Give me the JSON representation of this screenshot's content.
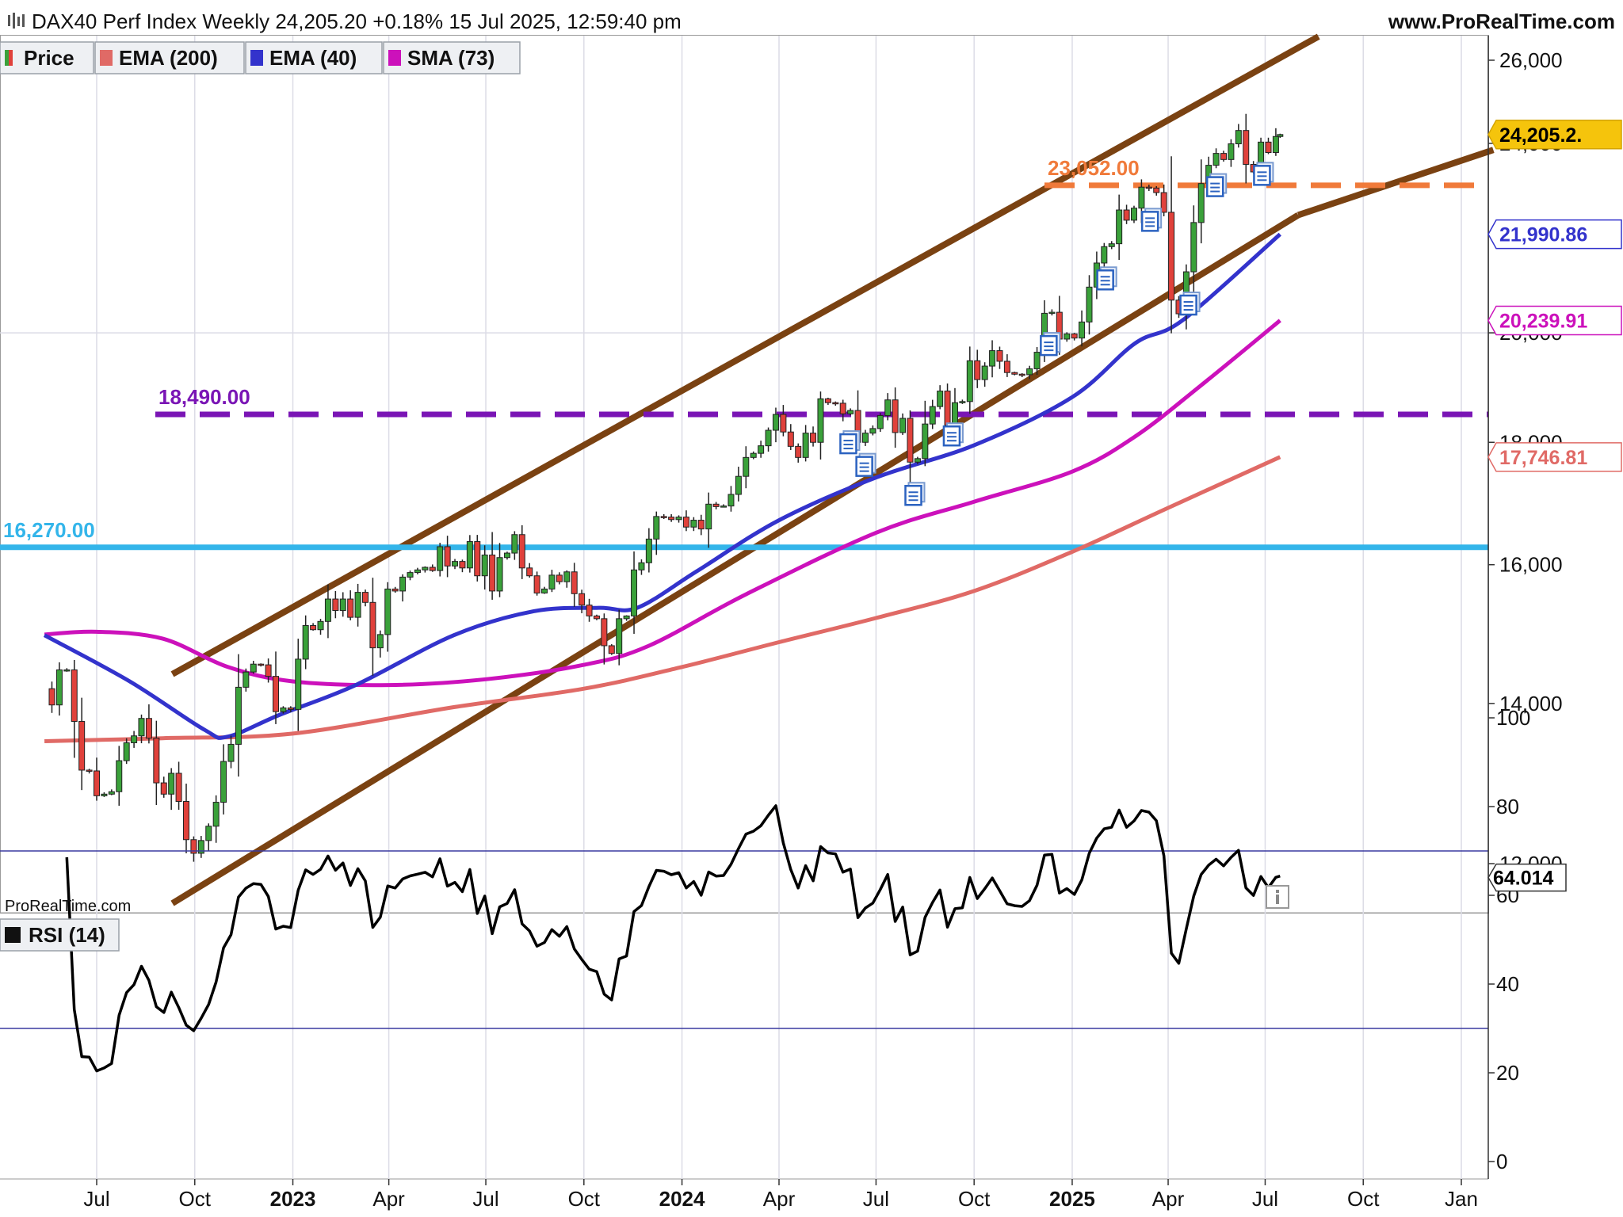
{
  "header": {
    "title": "DAX40 Perf Index Weekly 24,205.20 +0.18% 15 Jul 2025, 12:59:40 pm",
    "site": "www.ProRealTime.com",
    "watermark": "ProRealTime.com"
  },
  "legend": [
    {
      "label": "Price",
      "color": "#3aa13a",
      "color2": "#e0413b"
    },
    {
      "label": "EMA (200)",
      "color": "#e06a66"
    },
    {
      "label": "EMA (40)",
      "color": "#3333cc"
    },
    {
      "label": "SMA (73)",
      "color": "#cc11bb"
    }
  ],
  "rsi_legend": {
    "label": "RSI (14)",
    "color": "#111111"
  },
  "chart_data": [
    {
      "type": "candlestick",
      "name": "DAX40 Perf Index Weekly",
      "y_scale": "log",
      "ylim": [
        11400,
        26800
      ],
      "y_ticks": [
        12000,
        14000,
        16000,
        18000,
        20000,
        22000,
        24000,
        26000
      ],
      "y_tick_labels": [
        "12,000",
        "14,000",
        "16,000",
        "18,000",
        "20,000",
        "22,000",
        "24,000",
        "26,000"
      ],
      "x_tick_labels": [
        "Jul",
        "Oct",
        "2023",
        "Apr",
        "Jul",
        "Oct",
        "2024",
        "Apr",
        "Jul",
        "Oct",
        "2025",
        "Apr",
        "Jul",
        "Oct",
        "Jan"
      ],
      "x_tick_dates": [
        "2022-07-01",
        "2022-10-01",
        "2023-01-01",
        "2023-04-01",
        "2023-07-01",
        "2023-10-01",
        "2024-01-01",
        "2024-04-01",
        "2024-07-01",
        "2024-10-01",
        "2025-01-01",
        "2025-04-01",
        "2025-07-01",
        "2025-10-01",
        "2026-01-01"
      ],
      "x_year_labels": [
        "2023",
        "2024",
        "2025"
      ],
      "series_close": [
        [
          "2022-05-13",
          14200
        ],
        [
          "2022-05-20",
          13980
        ],
        [
          "2022-05-27",
          14460
        ],
        [
          "2022-06-03",
          14460
        ],
        [
          "2022-06-10",
          13760
        ],
        [
          "2022-06-17",
          13130
        ],
        [
          "2022-06-24",
          13120
        ],
        [
          "2022-07-01",
          12810
        ],
        [
          "2022-07-08",
          12830
        ],
        [
          "2022-07-15",
          12860
        ],
        [
          "2022-07-22",
          13250
        ],
        [
          "2022-07-29",
          13480
        ],
        [
          "2022-08-05",
          13570
        ],
        [
          "2022-08-12",
          13800
        ],
        [
          "2022-08-19",
          13540
        ],
        [
          "2022-08-26",
          12970
        ],
        [
          "2022-09-02",
          12830
        ],
        [
          "2022-09-09",
          13090
        ],
        [
          "2022-09-16",
          12740
        ],
        [
          "2022-09-23",
          12280
        ],
        [
          "2022-09-30",
          12120
        ],
        [
          "2022-10-07",
          12270
        ],
        [
          "2022-10-14",
          12440
        ],
        [
          "2022-10-21",
          12730
        ],
        [
          "2022-10-28",
          13240
        ],
        [
          "2022-11-04",
          13460
        ],
        [
          "2022-11-11",
          14220
        ],
        [
          "2022-11-18",
          14430
        ],
        [
          "2022-11-25",
          14540
        ],
        [
          "2022-12-02",
          14530
        ],
        [
          "2022-12-09",
          14370
        ],
        [
          "2022-12-16",
          13890
        ],
        [
          "2022-12-23",
          13940
        ],
        [
          "2022-12-30",
          13920
        ],
        [
          "2023-01-06",
          14610
        ],
        [
          "2023-01-13",
          15090
        ],
        [
          "2023-01-20",
          15030
        ],
        [
          "2023-01-27",
          15150
        ],
        [
          "2023-02-03",
          15480
        ],
        [
          "2023-02-10",
          15310
        ],
        [
          "2023-02-17",
          15480
        ],
        [
          "2023-02-24",
          15210
        ],
        [
          "2023-03-03",
          15580
        ],
        [
          "2023-03-10",
          15430
        ],
        [
          "2023-03-17",
          14770
        ],
        [
          "2023-03-24",
          14960
        ],
        [
          "2023-03-31",
          15630
        ],
        [
          "2023-04-07",
          15600
        ],
        [
          "2023-04-14",
          15810
        ],
        [
          "2023-04-21",
          15880
        ],
        [
          "2023-04-28",
          15920
        ],
        [
          "2023-05-05",
          15960
        ],
        [
          "2023-05-12",
          15910
        ],
        [
          "2023-05-19",
          16280
        ],
        [
          "2023-05-26",
          15980
        ],
        [
          "2023-06-02",
          16050
        ],
        [
          "2023-06-09",
          15950
        ],
        [
          "2023-06-16",
          16360
        ],
        [
          "2023-06-23",
          15830
        ],
        [
          "2023-06-30",
          16150
        ],
        [
          "2023-07-07",
          15600
        ],
        [
          "2023-07-14",
          16110
        ],
        [
          "2023-07-21",
          16180
        ],
        [
          "2023-07-28",
          16470
        ],
        [
          "2023-08-04",
          15950
        ],
        [
          "2023-08-11",
          15830
        ],
        [
          "2023-08-18",
          15570
        ],
        [
          "2023-08-25",
          15630
        ],
        [
          "2023-09-01",
          15840
        ],
        [
          "2023-09-08",
          15740
        ],
        [
          "2023-09-15",
          15890
        ],
        [
          "2023-09-22",
          15560
        ],
        [
          "2023-09-29",
          15390
        ],
        [
          "2023-10-06",
          15230
        ],
        [
          "2023-10-13",
          15190
        ],
        [
          "2023-10-20",
          14800
        ],
        [
          "2023-10-27",
          14690
        ],
        [
          "2023-11-03",
          15190
        ],
        [
          "2023-11-10",
          15230
        ],
        [
          "2023-11-17",
          15920
        ],
        [
          "2023-11-24",
          16030
        ],
        [
          "2023-12-01",
          16400
        ],
        [
          "2023-12-08",
          16760
        ],
        [
          "2023-12-15",
          16750
        ],
        [
          "2023-12-22",
          16710
        ],
        [
          "2023-12-29",
          16750
        ],
        [
          "2024-01-05",
          16590
        ],
        [
          "2024-01-12",
          16700
        ],
        [
          "2024-01-19",
          16560
        ],
        [
          "2024-01-26",
          16960
        ],
        [
          "2024-02-02",
          16920
        ],
        [
          "2024-02-09",
          16930
        ],
        [
          "2024-02-16",
          17120
        ],
        [
          "2024-02-23",
          17420
        ],
        [
          "2024-03-01",
          17740
        ],
        [
          "2024-03-08",
          17810
        ],
        [
          "2024-03-15",
          17940
        ],
        [
          "2024-03-22",
          18210
        ],
        [
          "2024-03-29",
          18490
        ],
        [
          "2024-04-05",
          18180
        ],
        [
          "2024-04-12",
          17930
        ],
        [
          "2024-04-19",
          17740
        ],
        [
          "2024-04-26",
          18160
        ],
        [
          "2024-05-03",
          18000
        ],
        [
          "2024-05-10",
          18770
        ],
        [
          "2024-05-17",
          18700
        ],
        [
          "2024-05-24",
          18690
        ],
        [
          "2024-05-31",
          18500
        ],
        [
          "2024-06-07",
          18560
        ],
        [
          "2024-06-14",
          18000
        ],
        [
          "2024-06-21",
          18160
        ],
        [
          "2024-06-28",
          18240
        ],
        [
          "2024-07-05",
          18470
        ],
        [
          "2024-07-12",
          18750
        ],
        [
          "2024-07-19",
          18170
        ],
        [
          "2024-07-26",
          18420
        ],
        [
          "2024-08-02",
          17660
        ],
        [
          "2024-08-09",
          17720
        ],
        [
          "2024-08-16",
          18320
        ],
        [
          "2024-08-23",
          18630
        ],
        [
          "2024-08-30",
          18910
        ],
        [
          "2024-09-06",
          18300
        ],
        [
          "2024-09-13",
          18700
        ],
        [
          "2024-09-20",
          18720
        ],
        [
          "2024-09-27",
          19470
        ],
        [
          "2024-10-04",
          19120
        ],
        [
          "2024-10-11",
          19370
        ],
        [
          "2024-10-18",
          19660
        ],
        [
          "2024-10-25",
          19460
        ],
        [
          "2024-11-01",
          19250
        ],
        [
          "2024-11-08",
          19220
        ],
        [
          "2024-11-15",
          19210
        ],
        [
          "2024-11-22",
          19320
        ],
        [
          "2024-11-29",
          19630
        ],
        [
          "2024-12-06",
          20380
        ],
        [
          "2024-12-13",
          20400
        ],
        [
          "2024-12-20",
          19880
        ],
        [
          "2024-12-27",
          19980
        ],
        [
          "2025-01-03",
          19900
        ],
        [
          "2025-01-10",
          20210
        ],
        [
          "2025-01-17",
          20900
        ],
        [
          "2025-01-24",
          21390
        ],
        [
          "2025-01-31",
          21730
        ],
        [
          "2025-02-07",
          21790
        ],
        [
          "2025-02-14",
          22510
        ],
        [
          "2025-02-21",
          22290
        ],
        [
          "2025-02-28",
          22550
        ],
        [
          "2025-03-07",
          23010
        ],
        [
          "2025-03-14",
          22990
        ],
        [
          "2025-03-21",
          22890
        ],
        [
          "2025-03-28",
          22460
        ],
        [
          "2025-04-04",
          20640
        ],
        [
          "2025-04-11",
          20370
        ],
        [
          "2025-04-18",
          21210
        ],
        [
          "2025-04-25",
          22240
        ],
        [
          "2025-05-02",
          23090
        ],
        [
          "2025-05-09",
          23500
        ],
        [
          "2025-05-16",
          23770
        ],
        [
          "2025-05-23",
          23630
        ],
        [
          "2025-05-30",
          23990
        ],
        [
          "2025-06-06",
          24300
        ],
        [
          "2025-06-13",
          23520
        ],
        [
          "2025-06-20",
          23350
        ],
        [
          "2025-06-27",
          24030
        ],
        [
          "2025-07-04",
          23790
        ],
        [
          "2025-07-11",
          24160
        ],
        [
          "2025-07-15",
          24205.2
        ]
      ],
      "last_price": "24,205.2.",
      "indicators": {
        "ema40_last": "21,990.86",
        "sma73_last": "20,239.91",
        "ema200_last": "17,746.81"
      },
      "ema40": [
        [
          "2022-05-13",
          14950
        ],
        [
          "2022-08-01",
          14300
        ],
        [
          "2022-10-10",
          13650
        ],
        [
          "2022-11-01",
          13560
        ],
        [
          "2022-12-20",
          13850
        ],
        [
          "2023-03-01",
          14250
        ],
        [
          "2023-06-01",
          14950
        ],
        [
          "2023-08-15",
          15300
        ],
        [
          "2023-10-15",
          15350
        ],
        [
          "2023-11-20",
          15350
        ],
        [
          "2024-01-15",
          15900
        ],
        [
          "2024-04-01",
          16700
        ],
        [
          "2024-07-01",
          17400
        ],
        [
          "2024-10-01",
          17950
        ],
        [
          "2025-01-01",
          18800
        ],
        [
          "2025-03-01",
          19800
        ],
        [
          "2025-04-15",
          20250
        ],
        [
          "2025-07-15",
          21990.86
        ]
      ],
      "sma73": [
        [
          "2022-05-13",
          14960
        ],
        [
          "2022-07-01",
          15000
        ],
        [
          "2022-09-01",
          14900
        ],
        [
          "2022-11-01",
          14500
        ],
        [
          "2023-01-01",
          14300
        ],
        [
          "2023-04-01",
          14250
        ],
        [
          "2023-07-01",
          14330
        ],
        [
          "2023-10-01",
          14530
        ],
        [
          "2023-12-01",
          14800
        ],
        [
          "2024-03-01",
          15550
        ],
        [
          "2024-07-01",
          16500
        ],
        [
          "2024-10-01",
          17000
        ],
        [
          "2025-01-01",
          17500
        ],
        [
          "2025-03-01",
          18100
        ],
        [
          "2025-05-01",
          19000
        ],
        [
          "2025-07-15",
          20239.91
        ]
      ],
      "ema200": [
        [
          "2022-05-13",
          13500
        ],
        [
          "2022-09-01",
          13540
        ],
        [
          "2023-01-01",
          13600
        ],
        [
          "2023-06-01",
          13950
        ],
        [
          "2023-10-01",
          14200
        ],
        [
          "2024-01-01",
          14500
        ],
        [
          "2024-04-01",
          14850
        ],
        [
          "2024-07-01",
          15200
        ],
        [
          "2024-10-01",
          15600
        ],
        [
          "2025-01-01",
          16200
        ],
        [
          "2025-04-01",
          16900
        ],
        [
          "2025-07-15",
          17746.81
        ]
      ],
      "channel_upper": [
        [
          "2022-09-10",
          14400
        ],
        [
          "2025-08-20",
          26600
        ]
      ],
      "channel_lower": [
        [
          "2022-09-10",
          11550
        ],
        [
          "2025-08-01",
          22400
        ]
      ],
      "channel_lower_ext": [
        [
          "2025-08-01",
          22400
        ],
        [
          "2026-01-31",
          23850
        ]
      ],
      "horizontal_lines": [
        {
          "value": 23052.0,
          "label": "23,052.00",
          "color": "#f07a3a",
          "dashed": true,
          "from": "2025-01-01"
        },
        {
          "value": 18490.0,
          "label": "18,490.00",
          "color": "#7a15b5",
          "dashed": true,
          "from": "2022-09-01"
        },
        {
          "value": 16270.0,
          "label": "16,270.00",
          "color": "#33b5ea",
          "dashed": false,
          "from": "2022-05-13"
        }
      ],
      "event_markers": [
        "2024-06-05",
        "2024-06-20",
        "2024-08-05",
        "2024-09-10",
        "2024-12-10",
        "2025-02-01",
        "2025-03-15",
        "2025-04-20",
        "2025-05-15",
        "2025-06-28"
      ]
    },
    {
      "type": "line",
      "name": "RSI (14)",
      "ylim": [
        -5,
        105
      ],
      "y_ticks": [
        0,
        20,
        40,
        60,
        80,
        100
      ],
      "y_tick_labels": [
        "0",
        "20",
        "40",
        "60",
        "80",
        "100"
      ],
      "levels": [
        30,
        70
      ],
      "last_value": "64.014"
    }
  ]
}
